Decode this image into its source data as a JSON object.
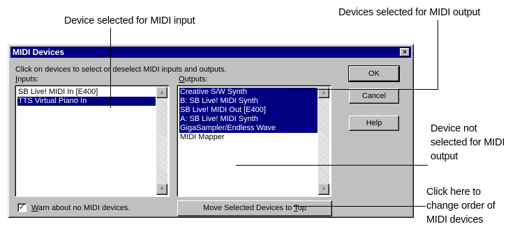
{
  "annotations": {
    "input_selected": "Device selected for MIDI input",
    "output_selected": "Devices selected for MIDI output",
    "not_selected_l1": "Device not",
    "not_selected_l2": "selected for MIDI",
    "not_selected_l3": "output",
    "change_order_l1": "Click here to",
    "change_order_l2": "change order of",
    "change_order_l3": "MIDI devices"
  },
  "dialog": {
    "title": "MIDI Devices",
    "close_glyph": "×",
    "instructions": "Click on devices to select or deselect MIDI inputs and outputs.",
    "inputs_label_first": "I",
    "inputs_label_rest": "nputs:",
    "outputs_label_first": "O",
    "outputs_label_rest": "utputs:",
    "inputs": [
      {
        "label": "SB Live! MIDI In [E400]",
        "selected": false
      },
      {
        "label": "TTS Virtual Piano In",
        "selected": true
      }
    ],
    "outputs": [
      {
        "label": "Creative S/W Synth",
        "selected": true
      },
      {
        "label": "B: SB Live! MIDI Synth",
        "selected": true
      },
      {
        "label": "SB Live! MIDI Out [E400]",
        "selected": true
      },
      {
        "label": "A: SB Live! MIDI Synth",
        "selected": true
      },
      {
        "label": "GigaSampler/Endless Wave",
        "selected": true
      },
      {
        "label": "MIDI Mapper",
        "selected": false
      }
    ],
    "ok_label": "OK",
    "cancel_label": "Cancel",
    "help_label": "Help",
    "warn_checked": true,
    "check_glyph": "✓",
    "warn_label_first": "W",
    "warn_label_rest": "arn about no MIDI devices.",
    "move_label_pre": "Move Selected Devices to ",
    "move_label_ul": "T",
    "move_label_post": "op",
    "scroll_up_glyph": "▲",
    "scroll_down_glyph": "▼"
  }
}
